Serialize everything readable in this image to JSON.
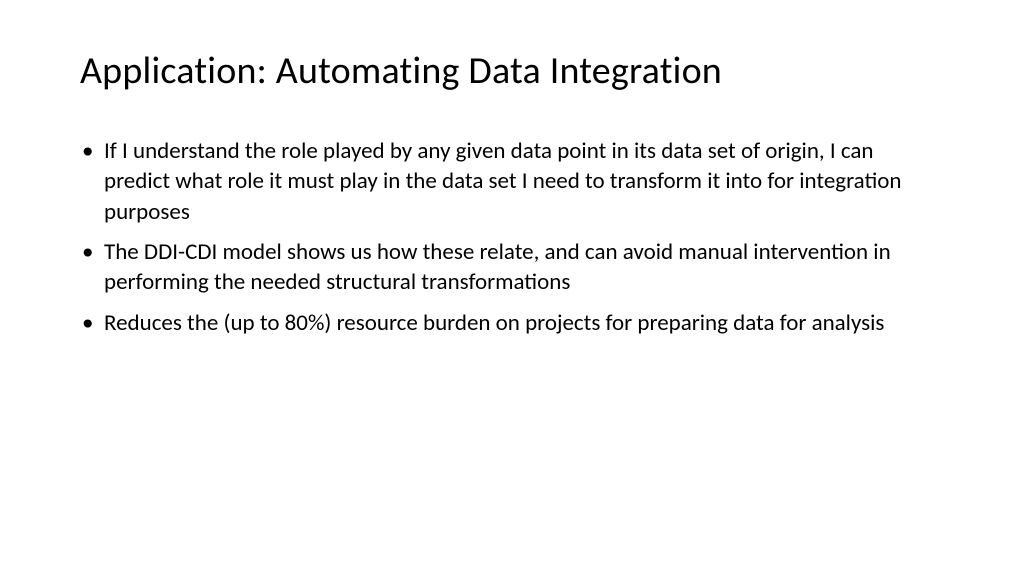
{
  "slide": {
    "title": "Application: Automating Data Integration",
    "bullets": [
      "If I understand the role played by any given data point in its data set of origin, I can predict what role it must play in the data set I need to transform it into for integration purposes",
      "The DDI-CDI model shows us how these relate, and can avoid manual intervention in performing the needed structural transformations",
      "Reduces the (up to 80%) resource burden on projects for preparing data for analysis"
    ]
  }
}
